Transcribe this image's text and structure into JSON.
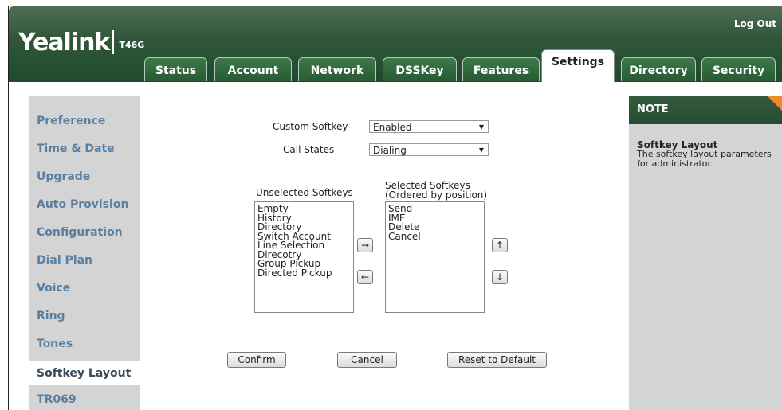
{
  "header": {
    "brand": "Yealink",
    "model": "T46G",
    "logout_label": "Log Out",
    "tabs": [
      "Status",
      "Account",
      "Network",
      "DSSKey",
      "Features",
      "Settings",
      "Directory",
      "Security"
    ],
    "active_tab": "Settings"
  },
  "sidebar": {
    "items": [
      "Preference",
      "Time & Date",
      "Upgrade",
      "Auto Provision",
      "Configuration",
      "Dial Plan",
      "Voice",
      "Ring",
      "Tones",
      "Softkey Layout",
      "TR069"
    ],
    "active_item": "Softkey Layout"
  },
  "form": {
    "custom_softkey_label": "Custom Softkey",
    "custom_softkey_value": "Enabled",
    "call_states_label": "Call States",
    "call_states_value": "Dialing",
    "unselected_label": "Unselected Softkeys",
    "selected_label_1": "Selected Softkeys",
    "selected_label_2": "(Ordered by position)",
    "unselected_items": [
      "Empty",
      "History",
      "Directory",
      "Switch Account",
      "Line Selection",
      "Direcotry",
      "Group Pickup",
      "Directed Pickup"
    ],
    "selected_items": [
      "Send",
      "IME",
      "Delete",
      "Cancel"
    ],
    "move_right_glyph": "→",
    "move_left_glyph": "←",
    "move_up_glyph": "↑",
    "move_down_glyph": "↓",
    "confirm_label": "Confirm",
    "cancel_label": "Cancel",
    "reset_label": "Reset to Default"
  },
  "note": {
    "heading": "NOTE",
    "title": "Softkey Layout",
    "text": "The softkey layout parameters for administrator."
  }
}
